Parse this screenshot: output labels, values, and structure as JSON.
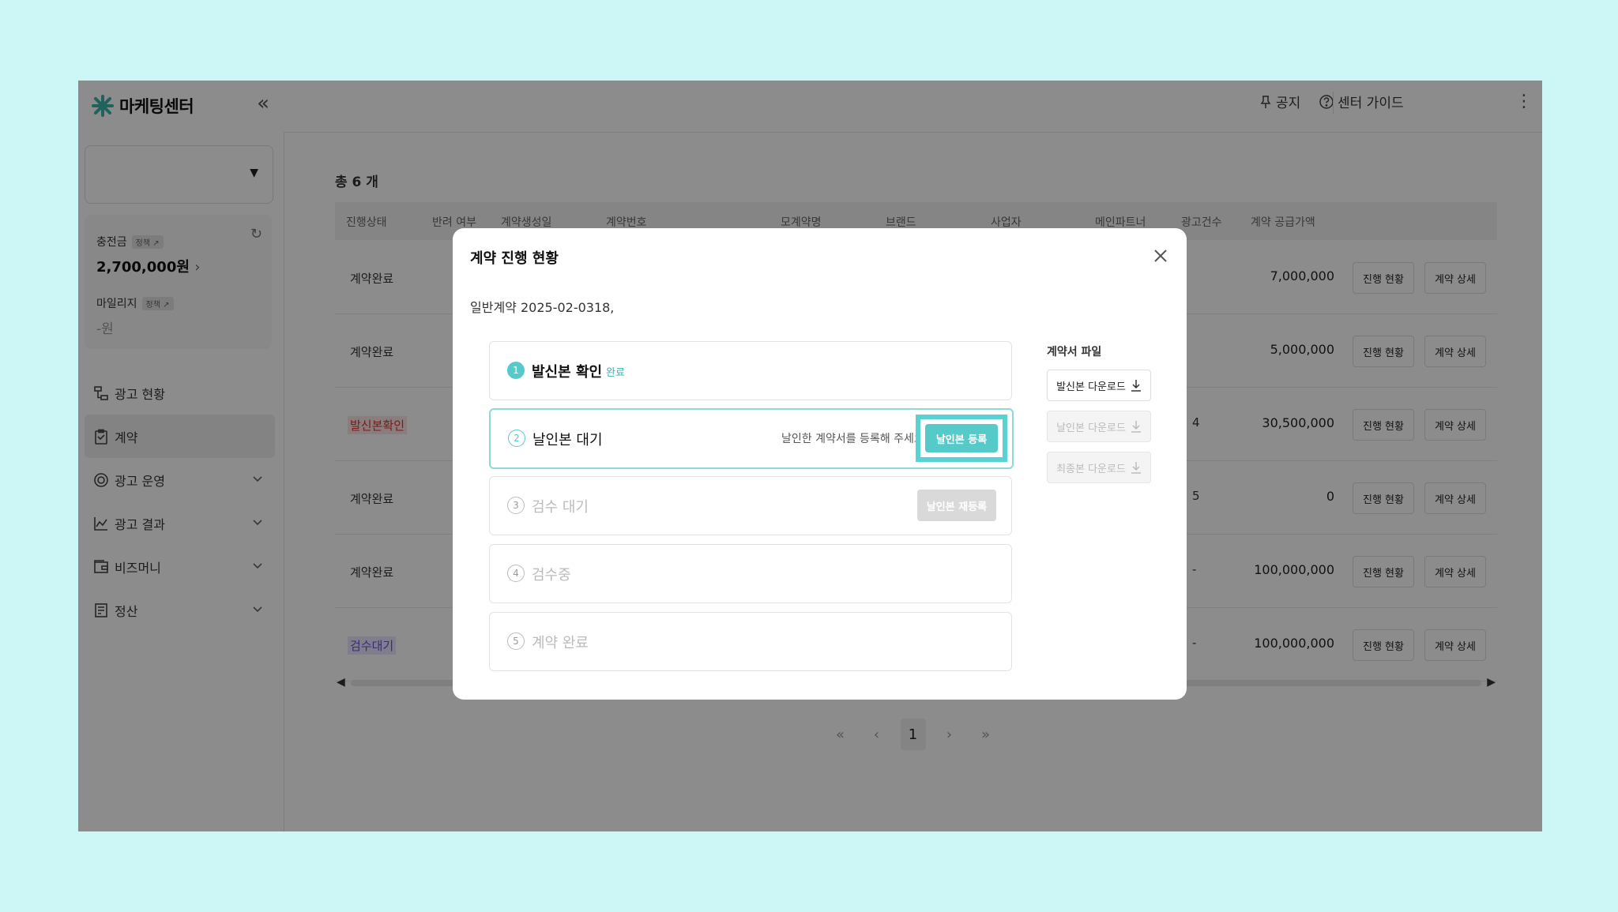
{
  "sidebar": {
    "brand": "마케팅센터",
    "charge_label": "충전금",
    "policy_tag": "정책 ↗",
    "charge_amount": "2,700,000원",
    "mileage_label": "마일리지",
    "mileage_value": "-원",
    "nav": [
      {
        "label": "광고 현황"
      },
      {
        "label": "계약"
      },
      {
        "label": "광고 운영"
      },
      {
        "label": "광고 결과"
      },
      {
        "label": "비즈머니"
      },
      {
        "label": "정산"
      }
    ]
  },
  "topbar": {
    "notice": "공지",
    "guide": "센터 가이드"
  },
  "table": {
    "total": "총 6 개",
    "headers": [
      "진행상태",
      "반려 여부",
      "계약생성일",
      "계약번호",
      "모계약명",
      "브랜드",
      "사업자",
      "메인파트너",
      "광고건수",
      "계약 공급가액"
    ],
    "rows": [
      {
        "status": "계약완료",
        "ad_count": "",
        "amount": "7,000,000"
      },
      {
        "status": "계약완료",
        "ad_count": "",
        "amount": "5,000,000"
      },
      {
        "status": "발신본확인",
        "ad_count": "4",
        "amount": "30,500,000"
      },
      {
        "status": "계약완료",
        "ad_count": "5",
        "amount": "0"
      },
      {
        "status": "계약완료",
        "ad_count": "-",
        "amount": "100,000,000"
      },
      {
        "status": "검수대기",
        "ad_count": "-",
        "amount": "100,000,000"
      }
    ],
    "btn_progress": "진행 현황",
    "btn_detail": "계약 상세",
    "page": "1"
  },
  "modal": {
    "title": "계약 진행 현황",
    "contract_no": "일반계약 2025-02-0318,",
    "steps": [
      {
        "num": "1",
        "label": "발신본 확인",
        "done": "완료"
      },
      {
        "num": "2",
        "label": "날인본 대기",
        "hint": "날인한 계약서를 등록해 주세요",
        "button": "날인본 등록"
      },
      {
        "num": "3",
        "label": "검수 대기",
        "button": "날인본 재등록"
      },
      {
        "num": "4",
        "label": "검수중"
      },
      {
        "num": "5",
        "label": "계약 완료"
      }
    ],
    "files_title": "계약서 파일",
    "files": [
      "발신본 다운로드",
      "날인본 다운로드",
      "최종본 다운로드"
    ]
  },
  "colors": {
    "accent": "#56c9c9",
    "page_bg": "#cdf6f6"
  }
}
